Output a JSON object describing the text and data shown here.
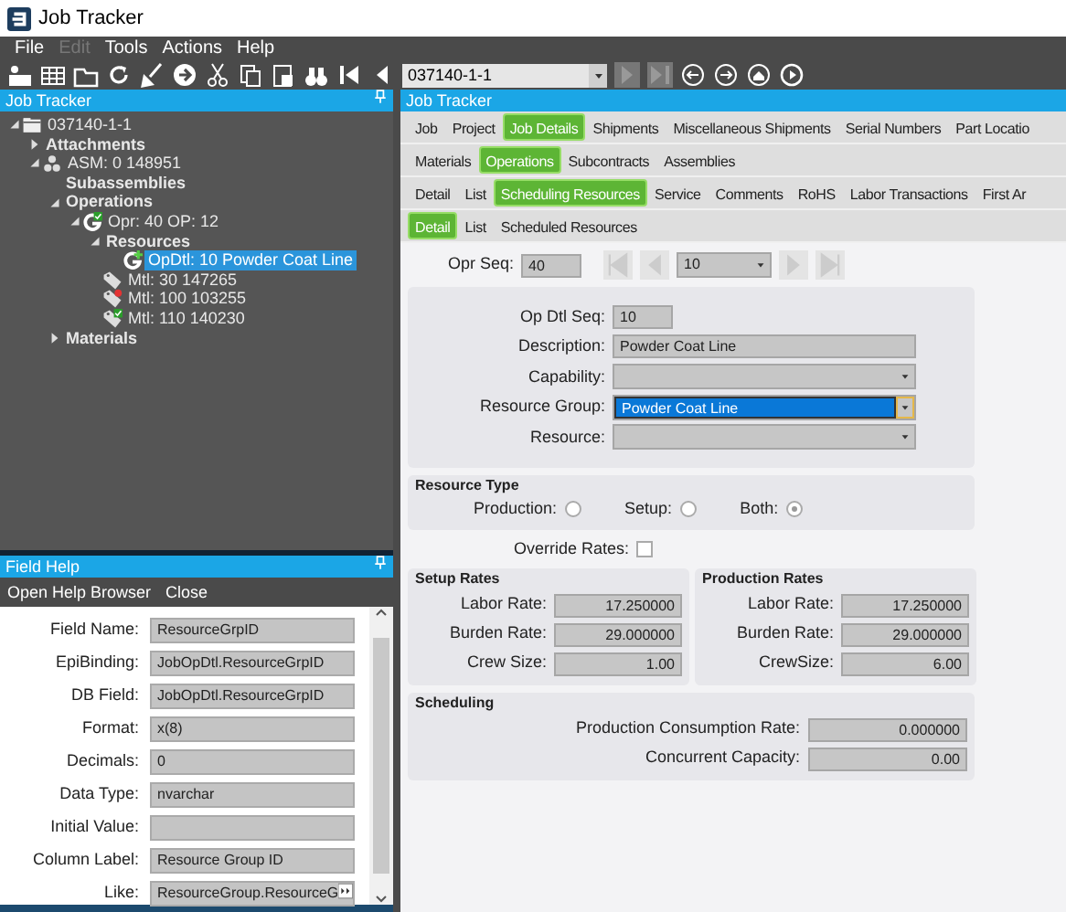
{
  "window": {
    "title": "Job Tracker"
  },
  "menu": [
    {
      "label": "File",
      "disabled": false
    },
    {
      "label": "Edit",
      "disabled": true
    },
    {
      "label": "Tools",
      "disabled": false
    },
    {
      "label": "Actions",
      "disabled": false
    },
    {
      "label": "Help",
      "disabled": false
    }
  ],
  "toolbar": {
    "job_combo": "037140-1-1"
  },
  "tree_panel": {
    "title": "Job Tracker",
    "nodes": [
      {
        "label": "037140-1-1",
        "kind": "job",
        "expanded": true,
        "selected": false,
        "children": [
          {
            "label": "Attachments",
            "kind": "group",
            "expanded": false,
            "selected": false
          },
          {
            "label": "ASM: 0 148951",
            "kind": "assembly",
            "expanded": true,
            "selected": false,
            "children": [
              {
                "label": "Subassemblies",
                "kind": "group",
                "selected": false
              },
              {
                "label": "Operations",
                "kind": "group",
                "expanded": true,
                "selected": false,
                "children": [
                  {
                    "label": "Opr: 40 OP: 12",
                    "kind": "operation",
                    "badge": {
                      "kind": "check",
                      "color": "#2a9d2a"
                    },
                    "expanded": true,
                    "selected": false,
                    "children": [
                      {
                        "label": "Resources",
                        "kind": "group",
                        "expanded": true,
                        "selected": false,
                        "children": [
                          {
                            "label": "OpDtl: 10 Powder Coat Line",
                            "kind": "resource",
                            "badge": {
                              "kind": "plus",
                              "color": "#55cc44"
                            },
                            "selected": true
                          }
                        ]
                      },
                      {
                        "label": "Mtl: 30 147265",
                        "kind": "material",
                        "selected": false
                      },
                      {
                        "label": "Mtl: 100 103255",
                        "kind": "material",
                        "badge": {
                          "kind": "dot",
                          "color": "#e33333"
                        },
                        "selected": false
                      },
                      {
                        "label": "Mtl: 110 140230",
                        "kind": "material",
                        "badge": {
                          "kind": "check",
                          "color": "#2a9d2a"
                        },
                        "selected": false
                      }
                    ]
                  }
                ]
              },
              {
                "label": "Materials",
                "kind": "group",
                "expanded": false,
                "selected": false
              }
            ]
          }
        ]
      }
    ]
  },
  "field_help": {
    "title": "Field Help",
    "actions": [
      "Open Help Browser",
      "Close"
    ],
    "fields": [
      {
        "label": "Field Name:",
        "value": "ResourceGrpID"
      },
      {
        "label": "EpiBinding:",
        "value": "JobOpDtl.ResourceGrpID"
      },
      {
        "label": "DB Field:",
        "value": "JobOpDtl.ResourceGrpID"
      },
      {
        "label": "Format:",
        "value": "x(8)"
      },
      {
        "label": "Decimals:",
        "value": "0"
      },
      {
        "label": "Data Type:",
        "value": "nvarchar"
      },
      {
        "label": "Initial Value:"
      },
      {
        "label": "Column Label:",
        "value": "Resource Group ID"
      },
      {
        "label": "Like:",
        "value": "ResourceGroup.ResourceG",
        "kind": "link"
      }
    ]
  },
  "main": {
    "title": "Job Tracker",
    "tab_rows": [
      [
        {
          "label": "Job",
          "selected": false
        },
        {
          "label": "Project",
          "selected": false
        },
        {
          "label": "Job Details",
          "selected": true
        },
        {
          "label": "Shipments",
          "selected": false
        },
        {
          "label": "Miscellaneous Shipments",
          "selected": false
        },
        {
          "label": "Serial Numbers",
          "selected": false
        },
        {
          "label": "Part Locatio",
          "selected": false
        }
      ],
      [
        {
          "label": "Materials",
          "selected": false
        },
        {
          "label": "Operations",
          "selected": true
        },
        {
          "label": "Subcontracts",
          "selected": false
        },
        {
          "label": "Assemblies",
          "selected": false
        }
      ],
      [
        {
          "label": "Detail",
          "selected": false
        },
        {
          "label": "List",
          "selected": false
        },
        {
          "label": "Scheduling Resources",
          "selected": true
        },
        {
          "label": "Service",
          "selected": false
        },
        {
          "label": "Comments",
          "selected": false
        },
        {
          "label": "RoHS",
          "selected": false
        },
        {
          "label": "Labor Transactions",
          "selected": false
        },
        {
          "label": "First Ar",
          "selected": false
        }
      ],
      [
        {
          "label": "Detail",
          "selected": true
        },
        {
          "label": "List",
          "selected": false
        },
        {
          "label": "Scheduled Resources",
          "selected": false
        }
      ]
    ],
    "opr_seq": {
      "label": "Opr Seq:",
      "value": "40",
      "detail_combo": "10"
    },
    "detail_fields": [
      {
        "label": "Op Dtl Seq:",
        "value": "10",
        "kind": "short"
      },
      {
        "label": "Description:",
        "value": "Powder Coat Line",
        "kind": "text"
      },
      {
        "label": "Capability:",
        "kind": "combo",
        "focused": false
      },
      {
        "label": "Resource Group:",
        "value": "Powder Coat Line",
        "kind": "combo",
        "focused": true
      },
      {
        "label": "Resource:",
        "kind": "combo",
        "focused": false
      }
    ],
    "resource_type": {
      "title": "Resource Type",
      "options": [
        {
          "label": "Production:",
          "selected": false
        },
        {
          "label": "Setup:",
          "selected": false
        },
        {
          "label": "Both:",
          "selected": true
        }
      ]
    },
    "override_rates": {
      "label": "Override Rates:",
      "checked": false
    },
    "setup_rates": {
      "title": "Setup Rates",
      "fields": [
        {
          "label": "Labor Rate:",
          "value": "17.250000"
        },
        {
          "label": "Burden Rate:",
          "value": "29.000000"
        },
        {
          "label": "Crew Size:",
          "value": "1.00"
        }
      ]
    },
    "production_rates": {
      "title": "Production Rates",
      "fields": [
        {
          "label": "Labor Rate:",
          "value": "17.250000"
        },
        {
          "label": "Burden Rate:",
          "value": "29.000000"
        },
        {
          "label": "CrewSize:",
          "value": "6.00"
        }
      ]
    },
    "scheduling": {
      "title": "Scheduling",
      "fields": [
        {
          "label": "Production Consumption Rate:",
          "value": "0.000000"
        },
        {
          "label": "Concurrent Capacity:",
          "value": "0.00"
        }
      ]
    }
  }
}
